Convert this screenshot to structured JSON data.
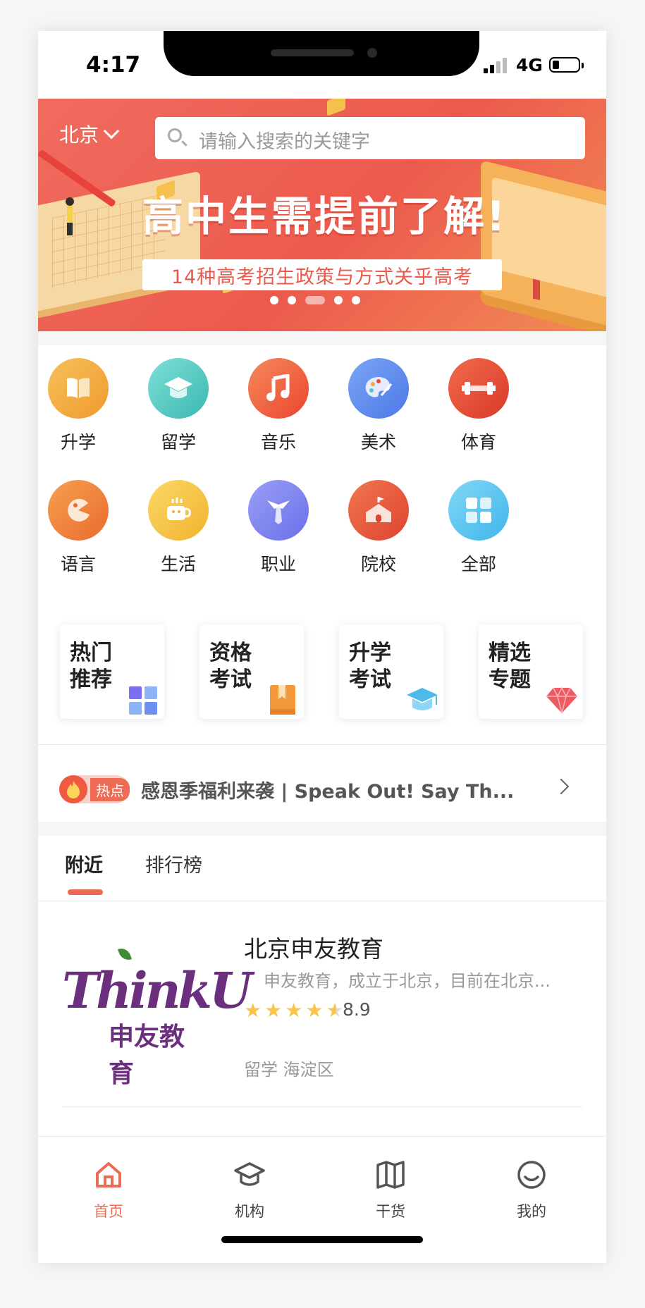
{
  "status_bar": {
    "time": "4:17",
    "network": "4G"
  },
  "header": {
    "city": "北京",
    "search_placeholder": "请输入搜索的关键字"
  },
  "banner": {
    "headline": "高中生需提前了解!",
    "subline": "14种高考招生政策与方式关乎高考",
    "slide_count": 5,
    "active_slide": 3
  },
  "categories": [
    {
      "label": "升学",
      "icon": "book-icon",
      "color": "#f2a93b"
    },
    {
      "label": "留学",
      "icon": "graduation-cap-icon",
      "color": "#4fc9c3"
    },
    {
      "label": "音乐",
      "icon": "music-note-icon",
      "color": "#ef5a3c"
    },
    {
      "label": "美术",
      "icon": "palette-icon",
      "color": "#5b86ee"
    },
    {
      "label": "体育",
      "icon": "dumbbell-icon",
      "color": "#ea4a36"
    },
    {
      "label": "语言",
      "icon": "speech-icon",
      "color": "#f0803a"
    },
    {
      "label": "生活",
      "icon": "coffee-cup-icon",
      "color": "#f7c84a"
    },
    {
      "label": "职业",
      "icon": "tie-icon",
      "color": "#7b7ef0"
    },
    {
      "label": "院校",
      "icon": "school-icon",
      "color": "#e95c43"
    },
    {
      "label": "全部",
      "icon": "grid-icon",
      "color": "#5bc6ef"
    }
  ],
  "feature_cards": [
    {
      "line1": "热门",
      "line2": "推荐",
      "icon": "grid-icon",
      "color": "#6f7ff0"
    },
    {
      "line1": "资格",
      "line2": "考试",
      "icon": "bookmark-book-icon",
      "color": "#f29a3b"
    },
    {
      "line1": "升学",
      "line2": "考试",
      "icon": "graduation-cap-icon",
      "color": "#4fb9ea"
    },
    {
      "line1": "精选",
      "line2": "专题",
      "icon": "diamond-icon",
      "color": "#ef5a62"
    }
  ],
  "hot_news": {
    "badge": "热点",
    "text": "感恩季福利来袭 | Speak Out! Say Th..."
  },
  "tabs": [
    {
      "label": "附近",
      "active": true
    },
    {
      "label": "排行榜",
      "active": false
    }
  ],
  "listing": {
    "logo_text": "ThinkU",
    "logo_cn": "申友教育",
    "name": "北京申友教育",
    "description": "申友教育，成立于北京，目前在北京...",
    "rating": "8.9",
    "stars": 4.5,
    "tags": "留学 海淀区"
  },
  "bottom_nav": [
    {
      "label": "首页",
      "icon": "home-icon",
      "active": true
    },
    {
      "label": "机构",
      "icon": "graduation-cap-icon",
      "active": false
    },
    {
      "label": "干货",
      "icon": "open-book-icon",
      "active": false
    },
    {
      "label": "我的",
      "icon": "smiley-icon",
      "active": false
    }
  ],
  "colors": {
    "accent": "#ec6b55",
    "banner": "#ec5a4d"
  }
}
